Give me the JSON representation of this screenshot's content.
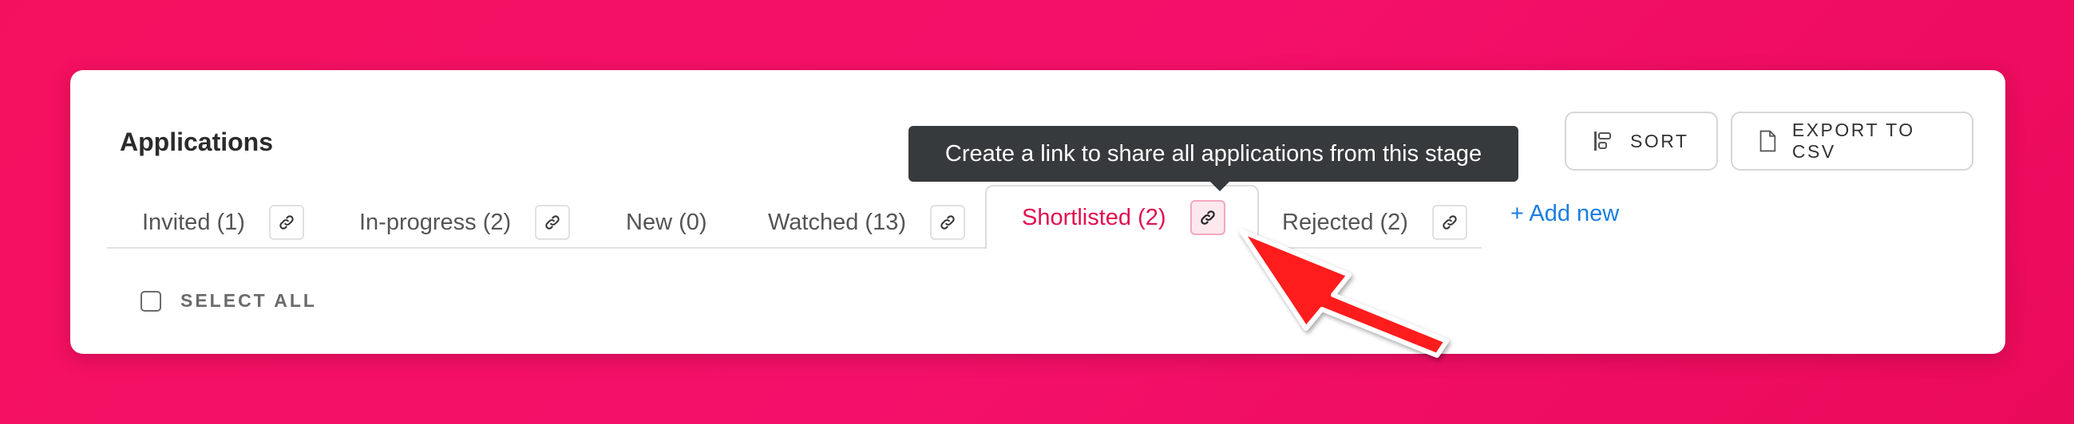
{
  "panel": {
    "title": "Applications"
  },
  "toolbar": {
    "sort_label": "SORT",
    "export_label": "EXPORT TO CSV"
  },
  "tooltip": {
    "text": "Create a link to share all applications from this stage"
  },
  "tabs": [
    {
      "label": "Invited (1)",
      "has_link": true
    },
    {
      "label": "In-progress (2)",
      "has_link": true
    },
    {
      "label": "New (0)",
      "has_link": false
    },
    {
      "label": "Watched (13)",
      "has_link": true
    },
    {
      "label": "Shortlisted (2)",
      "has_link": true,
      "active": true
    },
    {
      "label": "Rejected (2)",
      "has_link": true
    }
  ],
  "add_new_label": "+ Add new",
  "select_all_label": "SELECT ALL",
  "icons": {
    "sort": "sort-icon",
    "export": "csv-file-icon",
    "link": "link-icon",
    "annotation": "red-arrow-icon"
  },
  "colors": {
    "background": "#f5105f",
    "active_tab": "#e0104f",
    "link": "#1a7ee0",
    "tooltip": "#373a3c",
    "arrow": "#ff1a1a"
  }
}
